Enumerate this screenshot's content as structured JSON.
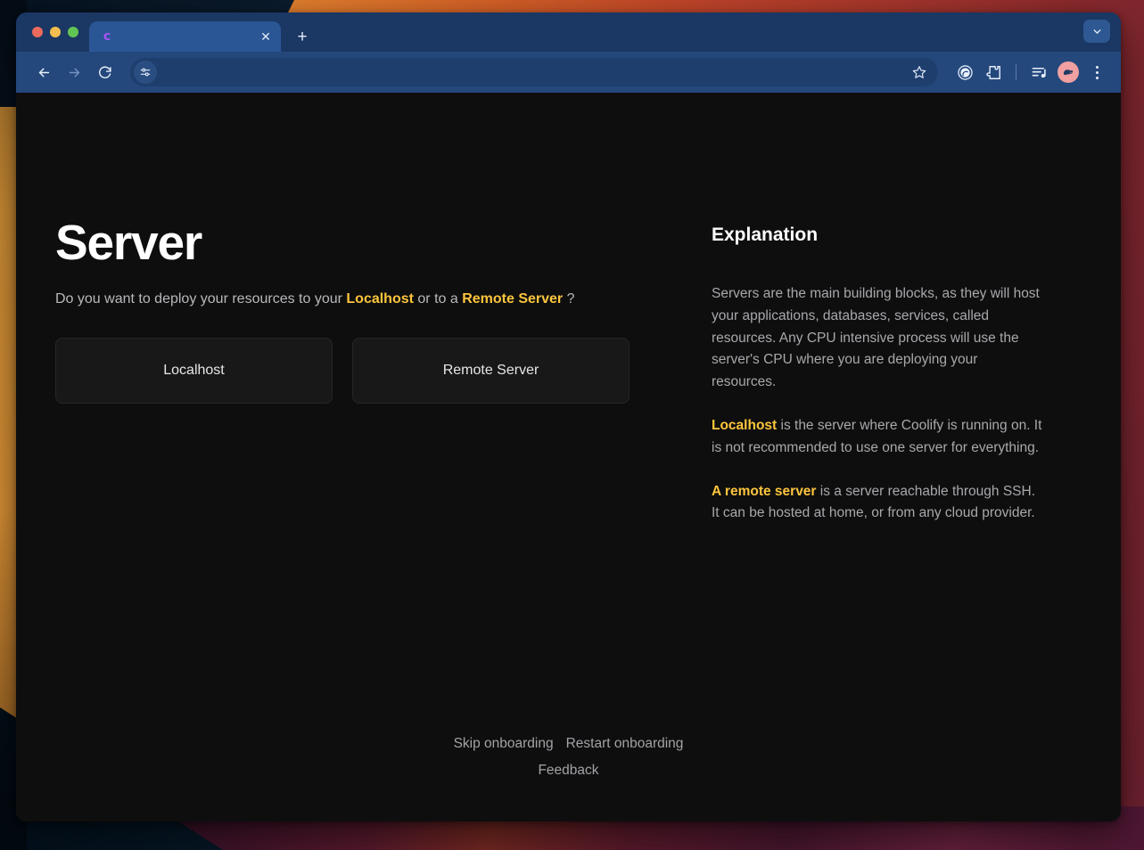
{
  "browser": {
    "tab": {
      "title": "",
      "favicon_icon": "coolify-c-logo-icon",
      "favicon_glyph": "c",
      "close_icon": "close-icon",
      "close_glyph": "✕"
    },
    "new_tab_glyph": "+",
    "tab_search_icon": "chevron-down-icon",
    "nav": {
      "back_icon": "back-arrow-icon",
      "back_glyph": "←",
      "forward_icon": "forward-arrow-icon",
      "forward_glyph": "→",
      "reload_icon": "reload-icon"
    },
    "omnibox": {
      "value": "",
      "placeholder": "",
      "lead_icon": "tune-sliders-icon",
      "bookmark_icon": "star-icon"
    },
    "toolbar_icons": [
      {
        "name": "gemini-circle-icon"
      },
      {
        "name": "extensions-puzzle-icon"
      },
      {
        "name": "media-playlist-icon"
      },
      {
        "name": "profile-avatar-icon"
      },
      {
        "name": "three-dot-menu-icon"
      }
    ],
    "traffic_lights": [
      "close",
      "minimize",
      "maximize"
    ]
  },
  "page": {
    "title": "Server",
    "subtitle": {
      "part1": "Do you want to deploy your resources to your ",
      "highlight1": "Localhost",
      "part2": " or to a ",
      "highlight2": "Remote Server",
      "part3": " ?"
    },
    "choices": [
      {
        "label": "Localhost"
      },
      {
        "label": "Remote Server"
      }
    ],
    "explanation": {
      "heading": "Explanation",
      "paragraphs": [
        {
          "lead": "",
          "text": "Servers are the main building blocks, as they will host your applications, databases, services, called resources. Any CPU intensive process will use the server's CPU where you are deploying your resources."
        },
        {
          "lead": "Localhost",
          "text": " is the server where Coolify is running on. It is not recommended to use one server for everything."
        },
        {
          "lead": "A remote server",
          "text": " is a server reachable through SSH. It can be hosted at home, or from any cloud provider."
        }
      ]
    },
    "footer": {
      "skip_label": "Skip onboarding",
      "restart_label": "Restart onboarding",
      "feedback_label": "Feedback"
    }
  },
  "colors": {
    "page_bg": "#0e0e0e",
    "accent_yellow": "#fcc53d",
    "button_bg": "#181818",
    "button_border": "#262626",
    "body_text": "#a8a8ad",
    "browser_chrome": "#24487c",
    "tab_active": "#2b5695"
  }
}
